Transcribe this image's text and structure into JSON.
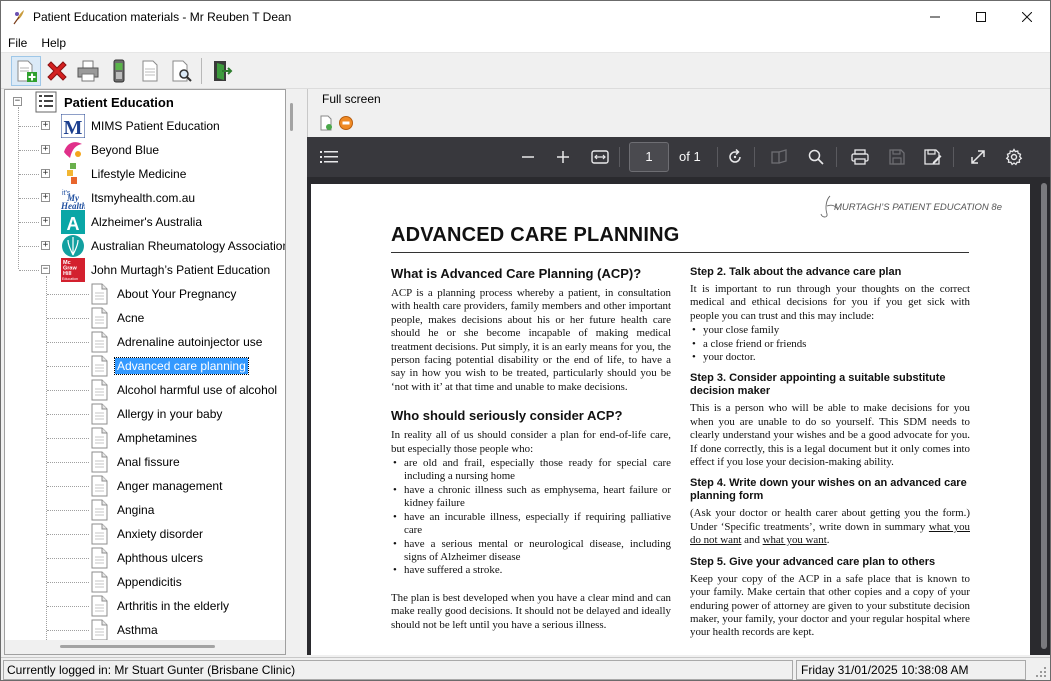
{
  "window": {
    "title": "Patient Education materials - Mr Reuben T Dean",
    "controls": [
      "minimize",
      "maximize",
      "close"
    ]
  },
  "menu": [
    "File",
    "Help"
  ],
  "toolbar": {
    "icons": [
      "add-document-icon",
      "delete-icon",
      "printer-icon",
      "mobile-phone-icon",
      "blank-document-icon",
      "preview-document-icon",
      "exit-door-icon"
    ]
  },
  "tree": {
    "root": "Patient Education",
    "providers": [
      {
        "label": "MIMS Patient Education",
        "icon": "mims-logo-icon",
        "color": "#1c3f8f"
      },
      {
        "label": "Beyond Blue",
        "icon": "beyond-blue-logo-icon",
        "color": "#e0308a"
      },
      {
        "label": "Lifestyle Medicine",
        "icon": "lifestyle-medicine-logo-icon",
        "color": "#6ab04c"
      },
      {
        "label": "Itsmyhealth.com.au",
        "icon": "itsmyhealth-logo-icon",
        "color": "#1f4fa0"
      },
      {
        "label": "Alzheimer's Australia",
        "icon": "alzheimers-logo-icon",
        "color": "#0aa6a6"
      },
      {
        "label": "Australian Rheumatology Association",
        "icon": "rheumatology-logo-icon",
        "color": "#12a0a0"
      },
      {
        "label": "John Murtagh’s Patient Education",
        "icon": "mcgraw-hill-logo-icon",
        "color": "#d3202e",
        "logo_text": [
          "Mc",
          "Graw",
          "Hill",
          "Education"
        ]
      }
    ],
    "documents": [
      "About Your Pregnancy",
      "Acne",
      "Adrenaline autoinjector use",
      "Advanced care planning",
      "Alcohol harmful use of alcohol",
      "Allergy in your baby",
      "Amphetamines",
      "Anal fissure",
      "Anger management",
      "Angina",
      "Anxiety disorder",
      "Aphthous ulcers",
      "Appendicitis",
      "Arthritis in the elderly",
      "Asthma"
    ],
    "selected": "Advanced care planning"
  },
  "viewer": {
    "fullscreen_label": "Full screen",
    "pdf": {
      "page": "1",
      "of_label": "of 1"
    }
  },
  "document": {
    "brand": "MURTAGH’S PATIENT EDUCATION 8e",
    "title": "ADVANCED CARE PLANNING",
    "left": {
      "h1": "What is Advanced Care Planning (ACP)?",
      "p1": "ACP is a planning process whereby a patient, in consultation with health care providers, family members and other important people, makes decisions about his or her future health care should he or she become incapable of making medical treatment decisions. Put simply, it is an early means for you, the person facing potential disability or the end of life, to have a say in how you wish to be treated, particularly should you be ‘not with it’ at that time and unable to make decisions.",
      "h2": "Who should seriously consider ACP?",
      "p2": "In reality all of us should consider a plan for end-of-life care, but especially those people who:",
      "bullets": [
        "are old and frail, especially those ready for special care including a nursing home",
        "have a chronic illness such as emphysema, heart failure or kidney failure",
        "have an incurable illness, especially if requiring palliative care",
        "have a serious mental or neurological disease, including signs of Alzheimer disease",
        "have suffered a stroke."
      ],
      "p3": "The plan is best developed when you have a clear mind and can make really good decisions. It should not be delayed and ideally should not be left until you have a serious illness."
    },
    "right": {
      "s2_h": "Step 2. Talk about the advance care plan",
      "s2_p": "It is important to run through your thoughts on the correct medical and ethical decisions for you if you get sick with people you can trust and this may include:",
      "s2_bullets": [
        "your close family",
        "a close friend or friends",
        "your doctor."
      ],
      "s3_h": "Step 3. Consider appointing a suitable substitute decision maker",
      "s3_p": "This is a person who will be able to make decisions for you when you are unable to do so yourself. This SDM needs to clearly understand your wishes and be a good advocate for you. If done correctly, this is a legal document but it only comes into effect if you lose your decision-making ability.",
      "s4_h": "Step 4. Write down your wishes on an advanced care planning form",
      "s4_p_a": "(Ask your doctor or health carer about getting you the form.) Under ‘Specific treatments’, write down in summary ",
      "s4_u1": "what you do not want",
      "s4_and": " and ",
      "s4_u2": "what you want",
      "s4_end": ".",
      "s5_h": "Step 5. Give your advanced care plan to others",
      "s5_p": "Keep your copy of the ACP in a safe place that is known to your family. Make certain that other copies and a copy of your enduring power of attorney are given to your substitute decision maker, your family, your doctor and your regular hospital where your health records are kept."
    }
  },
  "status": {
    "logged_in": "Currently logged in:  Mr Stuart Gunter (Brisbane Clinic)",
    "datetime": "Friday 31/01/2025 10:38:08 AM"
  }
}
